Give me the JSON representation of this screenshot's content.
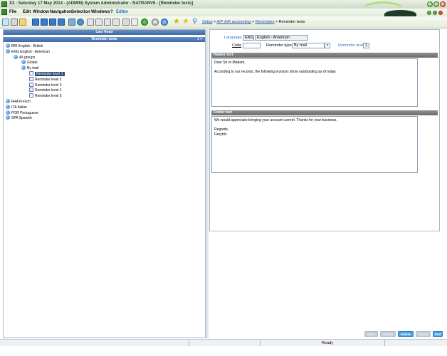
{
  "window": {
    "title": "X3 - Saturday 17 May 2014 - (ADMIN) System Administrator - NATRANV6 - [Reminder texts]"
  },
  "menu": {
    "items": [
      "File",
      "Edit",
      "Window",
      "Navigation",
      "Selection",
      "Windows",
      "?",
      "Editor"
    ]
  },
  "breadcrumb": {
    "setup": "Setup",
    "sep1": ">",
    "accounting": "A/P-A/R accounting",
    "sep2": ">",
    "reminders": "Reminders",
    "sep3": ">",
    "current": "Reminder texts"
  },
  "leftpane": {
    "last_read_label": "Last Read",
    "reminder_texts_label": "Reminder texts",
    "pin_label": "‡ ×",
    "tree": [
      {
        "label": "BRI English - British",
        "level": 0,
        "icon": "globe-icon"
      },
      {
        "label": "ENG English - American",
        "level": 0,
        "icon": "globe-open-icon"
      },
      {
        "label": "All groups",
        "level": 1,
        "icon": "globe-open-icon"
      },
      {
        "label": "Global",
        "level": 2,
        "icon": "globe-icon"
      },
      {
        "label": "By mail",
        "level": 2,
        "icon": "globe-open-icon"
      },
      {
        "label": "Reminder level 1",
        "level": 3,
        "icon": "document-icon",
        "selected": true
      },
      {
        "label": "Reminder level 2",
        "level": 3,
        "icon": "document-icon"
      },
      {
        "label": "Reminder level 3",
        "level": 3,
        "icon": "document-icon"
      },
      {
        "label": "Reminder level 4",
        "level": 3,
        "icon": "document-icon"
      },
      {
        "label": "Reminder level 5",
        "level": 3,
        "icon": "document-icon"
      },
      {
        "label": "FRA French",
        "level": 0,
        "icon": "globe-icon"
      },
      {
        "label": "ITA Italian",
        "level": 0,
        "icon": "globe-icon"
      },
      {
        "label": "POR Portuguese",
        "level": 0,
        "icon": "globe-icon"
      },
      {
        "label": "SPA Spanish",
        "level": 0,
        "icon": "globe-icon"
      }
    ]
  },
  "form": {
    "language_label": "Language",
    "language_code": "ENG",
    "language_name": "English - American",
    "code_label": "Code",
    "code_value": "",
    "reminder_type_label": "Reminder type",
    "reminder_type_value": "By mail",
    "reminder_level_label": "Reminder level",
    "reminder_level_value": "1"
  },
  "header_text": {
    "title": "Header text",
    "content": "Dear Sir or Madam,\n\nAccording to our records, the following invoices show outstanding as of today."
  },
  "footer_text": {
    "title": "Footer text",
    "content": "We would appreciate bringing your account current. Thanks for your business.\n\nRegards,\nGreytrix"
  },
  "buttons": {
    "save": "Save",
    "create": "Create",
    "delete": "Delete",
    "cancel": "Cancel",
    "end": "End"
  },
  "status": {
    "ready": "Ready"
  },
  "colors": {
    "accent": "#2a6fc6",
    "tree_selected": "#2d4a78",
    "section_header": "#7a7a7a"
  }
}
